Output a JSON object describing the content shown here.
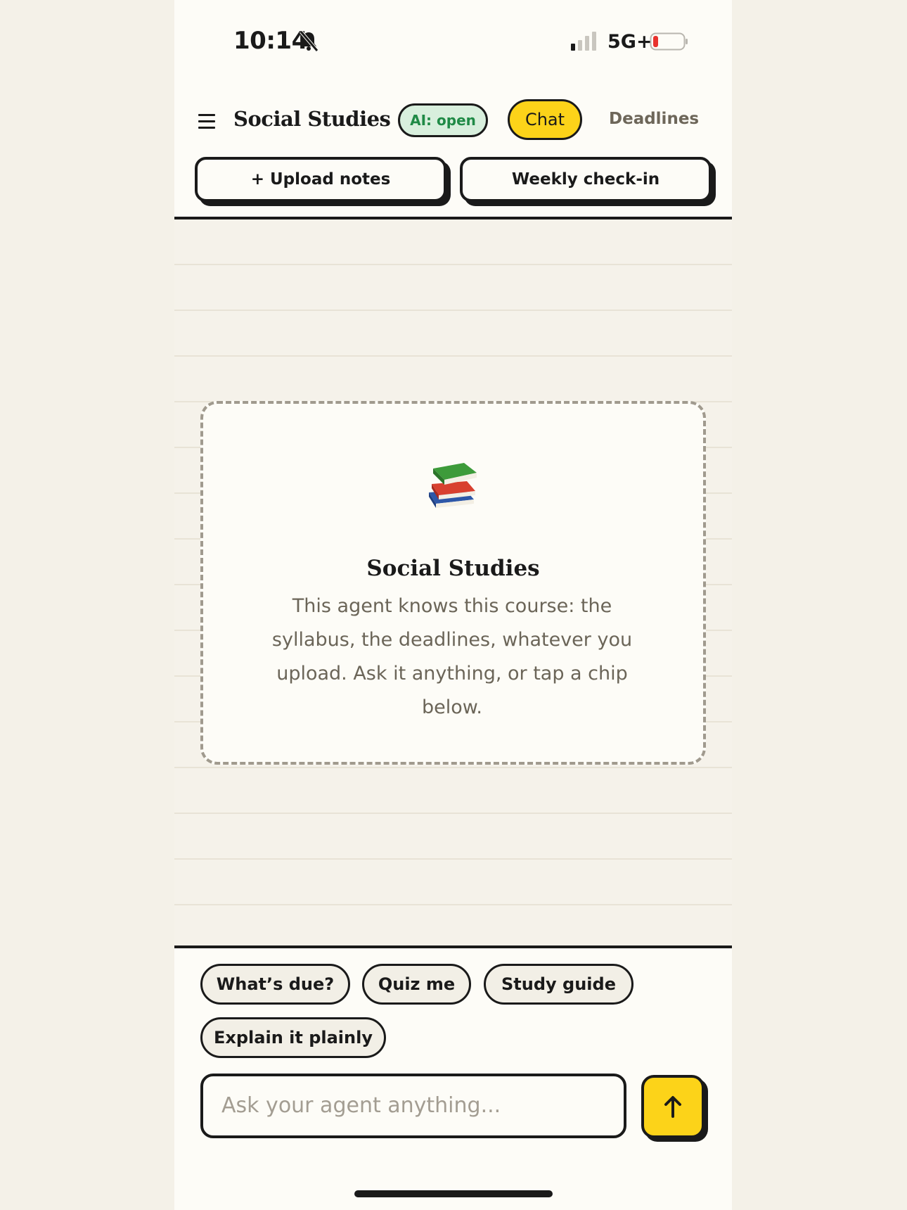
{
  "status_bar": {
    "time": "10:14",
    "network": "5G+"
  },
  "header": {
    "course_title": "Social Studies",
    "ai_badge": "AI: open",
    "tabs": [
      {
        "label": "Chat"
      },
      {
        "label": "Deadlines"
      }
    ]
  },
  "actions": {
    "upload_label": "+ Upload notes",
    "weekly_label": "Weekly check-in"
  },
  "empty_state": {
    "title": "Social Studies",
    "body": "This agent knows this course: the syllabus, the deadlines, whatever you upload. Ask it anything, or tap a chip below."
  },
  "chips": [
    {
      "label": "What’s due?"
    },
    {
      "label": "Quiz me"
    },
    {
      "label": "Study guide"
    },
    {
      "label": "Explain it plainly"
    }
  ],
  "composer": {
    "placeholder": "Ask your agent anything..."
  },
  "colors": {
    "accent": "#fcd319",
    "badge_bg": "#d8efdd",
    "badge_text": "#1f8a46",
    "ink": "#1a1a1a"
  },
  "icons": {
    "menu": "hamburger-icon",
    "bell": "bell-slash-icon",
    "send": "arrow-up-icon",
    "books": "books-icon"
  }
}
